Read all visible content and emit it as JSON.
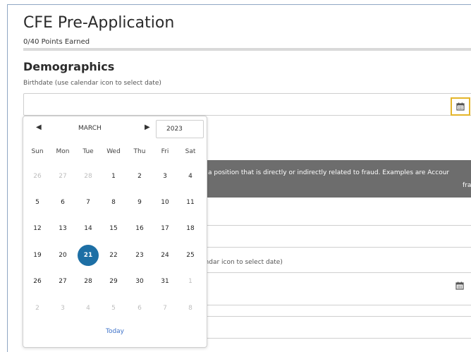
{
  "header": {
    "title": "CFE Pre-Application",
    "points": "0/40 Points Earned",
    "progress": 0
  },
  "section": {
    "title": "Demographics",
    "birthdate_label": "Birthdate (use calendar icon to select date)"
  },
  "banner": {
    "line1": "a position that is directly or indirectly related to fraud. Examples are Accour",
    "line2": "fra"
  },
  "hint2": "endar icon to select date)",
  "icons": {
    "calendar": "calendar-icon",
    "prev": "triangle-left",
    "next": "triangle-right"
  },
  "colors": {
    "focus_outline": "#e4b52a",
    "selected_day": "#1d6fa5",
    "banner_bg": "#6d6d6d",
    "today_link": "#3e72c9"
  },
  "datepicker": {
    "prev": "◀",
    "next": "▶",
    "month": "MARCH",
    "year": "2023",
    "weekdays": [
      "Sun",
      "Mon",
      "Tue",
      "Wed",
      "Thu",
      "Fri",
      "Sat"
    ],
    "weeks": [
      [
        "26",
        "27",
        "28",
        "1",
        "2",
        "3",
        "4"
      ],
      [
        "5",
        "6",
        "7",
        "8",
        "9",
        "10",
        "11"
      ],
      [
        "12",
        "13",
        "14",
        "15",
        "16",
        "17",
        "18"
      ],
      [
        "19",
        "20",
        "21",
        "22",
        "23",
        "24",
        "25"
      ],
      [
        "26",
        "27",
        "28",
        "29",
        "30",
        "31",
        "1"
      ],
      [
        "2",
        "3",
        "4",
        "5",
        "6",
        "7",
        "8"
      ]
    ],
    "selected": "21",
    "today": "Today"
  }
}
